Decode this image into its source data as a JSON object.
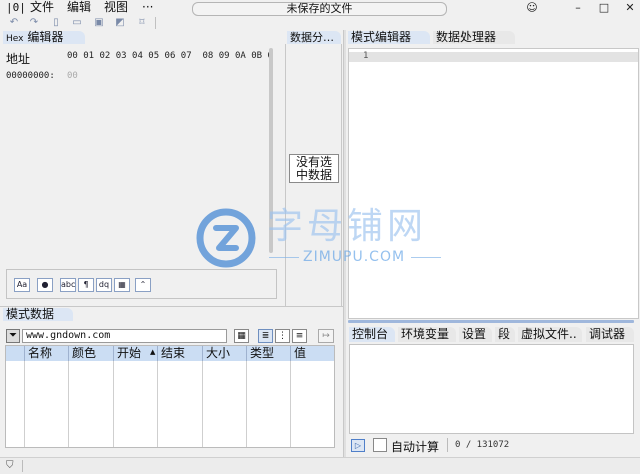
{
  "menu": {
    "logo": "|0|",
    "items": [
      "文件",
      "编辑",
      "视图",
      "···"
    ]
  },
  "window": {
    "title": "未保存的文件",
    "controls": {
      "emoji": "☺",
      "minimize": "–",
      "maximize": "□",
      "close": "✕"
    }
  },
  "toolbar": {
    "icons": [
      "undo-icon",
      "redo-icon",
      "new-file-icon",
      "open-file-icon",
      "save-icon",
      "save-as-icon",
      "bookmark-icon"
    ]
  },
  "hex_editor": {
    "tab_prefix": "Hex",
    "tab_label": "编辑器",
    "address_label": "地址",
    "columns": "00 01 02 03 04 05 06 07  08 09 0A 0B 0",
    "row_address": "00000000:",
    "row_value": "00",
    "bottom_buttons": [
      "Aa",
      "●",
      "abc",
      "¶",
      "dq",
      "▦",
      "⌃"
    ]
  },
  "data_analyzer": {
    "tab_label": "数据分…",
    "empty_text_line1": "没有选",
    "empty_text_line2": "中数据"
  },
  "pattern_editor": {
    "tabs": [
      "模式编辑器",
      "数据处理器"
    ],
    "line_number": "1"
  },
  "pattern_data": {
    "tab_label": "模式数据",
    "filter_value": "www.gndown.com",
    "columns": [
      "名称",
      "颜色",
      "开始",
      "结束",
      "大小",
      "类型",
      "值"
    ],
    "sort_indicator": "▲"
  },
  "console": {
    "tabs": [
      "控制台",
      "环境变量",
      "设置",
      "段",
      "虚拟文件..",
      "调试器"
    ],
    "auto_calc_label": "自动计算",
    "progress_text": "0 / 131072"
  },
  "watermark": {
    "main": "字母铺网",
    "sub": "ZIMUPU.COM"
  },
  "colors": {
    "accent": "#2f7ad1",
    "tab_active": "#dce6f4",
    "table_header": "#cbddf3"
  }
}
